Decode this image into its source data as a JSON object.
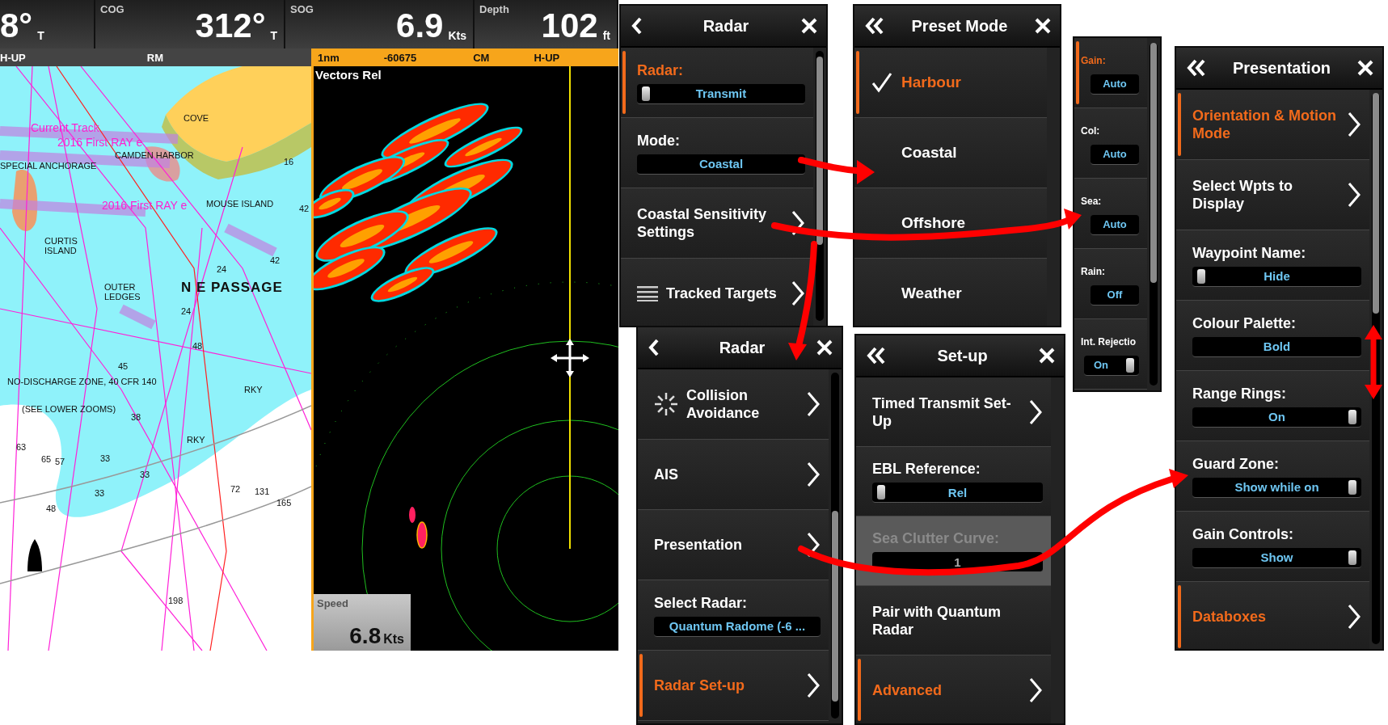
{
  "instruments": [
    {
      "value": "8°",
      "unit": "T"
    },
    {
      "label": "COG",
      "value": "312°",
      "unit": "T"
    },
    {
      "label": "SOG",
      "value": "6.9",
      "unit": "Kts"
    },
    {
      "label": "Depth",
      "value": "102",
      "unit": "ft"
    }
  ],
  "chart": {
    "header": [
      "H-UP",
      "RM"
    ],
    "labels": [
      "Current Track",
      "2016 First RAY e",
      "2016 First RAY e",
      "COVE",
      "SPECIAL ANCHORAGE",
      "CAMDEN HARBOR",
      "MOUSE ISLAND",
      "CURTIS ISLAND",
      "OUTER LEDGES",
      "N E PASSAGE",
      "NO-DISCHARGE ZONE, 40 CFR 140",
      "(SEE LOWER ZOOMS)",
      "RKY",
      "RKY",
      "16",
      "42",
      "24",
      "42",
      "24",
      "48",
      "45",
      "38",
      "63",
      "65",
      "57",
      "33",
      "33",
      "33",
      "48",
      "72",
      "131",
      "165",
      "198"
    ]
  },
  "radar": {
    "header": [
      "1nm",
      "-60675",
      "CM",
      "H-UP"
    ],
    "overlay": "Vectors Rel",
    "speed": {
      "label": "Speed",
      "value": "6.8",
      "unit": "Kts"
    }
  },
  "panels": [
    {
      "title": "Radar",
      "items": [
        {
          "kind": "toggle",
          "label": "Radar:",
          "value": "Transmit",
          "on": false,
          "selected": true
        },
        {
          "kind": "field",
          "label": "Mode:",
          "value": "Coastal",
          "selected": false
        },
        {
          "kind": "submenu",
          "label": "Coastal Sensitivity Settings",
          "selected": false
        },
        {
          "kind": "submenu",
          "label": "Tracked Targets",
          "selected": false
        }
      ]
    },
    {
      "title": "Preset Mode",
      "items": [
        {
          "kind": "option",
          "label": "Harbour",
          "checked": true,
          "selected": true
        },
        {
          "kind": "option",
          "label": "Coastal",
          "checked": false,
          "selected": false
        },
        {
          "kind": "option",
          "label": "Offshore",
          "checked": false,
          "selected": false
        },
        {
          "kind": "option",
          "label": "Weather",
          "checked": false,
          "selected": false
        }
      ]
    },
    {
      "items": [
        {
          "kind": "field",
          "label": "Gain:",
          "value": "Auto",
          "selected": true
        },
        {
          "kind": "field",
          "label": "Col:",
          "value": "Auto",
          "selected": false
        },
        {
          "kind": "field",
          "label": "Sea:",
          "value": "Auto",
          "selected": false
        },
        {
          "kind": "field",
          "label": "Rain:",
          "value": "Off",
          "selected": false
        },
        {
          "kind": "toggle",
          "label": "Int. Rejectio",
          "value": "On",
          "on": true,
          "selected": false
        }
      ]
    },
    {
      "title": "Presentation",
      "items": [
        {
          "kind": "submenu",
          "label": "Orientation & Motion Mode",
          "selected": true
        },
        {
          "kind": "submenu",
          "label": "Select Wpts to Display",
          "selected": false
        },
        {
          "kind": "toggle",
          "label": "Waypoint Name:",
          "value": "Hide",
          "on": false,
          "selected": false
        },
        {
          "kind": "field",
          "label": "Colour Palette:",
          "value": "Bold",
          "selected": false
        },
        {
          "kind": "toggle",
          "label": "Range Rings:",
          "value": "On",
          "on": true,
          "selected": false
        },
        {
          "kind": "toggle",
          "label": "Guard Zone:",
          "value": "Show while on",
          "on": true,
          "selected": false
        },
        {
          "kind": "toggle",
          "label": "Gain Controls:",
          "value": "Show",
          "on": true,
          "selected": false
        },
        {
          "kind": "submenu",
          "label": "Databoxes",
          "selected": true
        }
      ]
    },
    {
      "title": "Radar",
      "items": [
        {
          "kind": "submenu",
          "label": "Collision Avoidance",
          "selected": false
        },
        {
          "kind": "submenu",
          "label": "AIS",
          "selected": false
        },
        {
          "kind": "submenu",
          "label": "Presentation",
          "selected": false
        },
        {
          "kind": "field",
          "label": "Select Radar:",
          "value": "Quantum Radome (-6 ...",
          "selected": false
        },
        {
          "kind": "submenu",
          "label": "Radar Set-up",
          "selected": true
        }
      ]
    },
    {
      "title": "Set-up",
      "items": [
        {
          "kind": "submenu",
          "label": "Timed Transmit Set-Up",
          "selected": false,
          "disabled": false
        },
        {
          "kind": "toggle",
          "label": "EBL Reference:",
          "value": "Rel",
          "on": false,
          "selected": false,
          "disabled": false
        },
        {
          "kind": "field",
          "label": "Sea Clutter Curve:",
          "value": "1",
          "selected": false,
          "disabled": true
        },
        {
          "kind": "action",
          "label": "Pair with Quantum Radar",
          "selected": false,
          "disabled": false
        },
        {
          "kind": "submenu",
          "label": "Advanced",
          "selected": true,
          "disabled": false
        }
      ]
    }
  ]
}
